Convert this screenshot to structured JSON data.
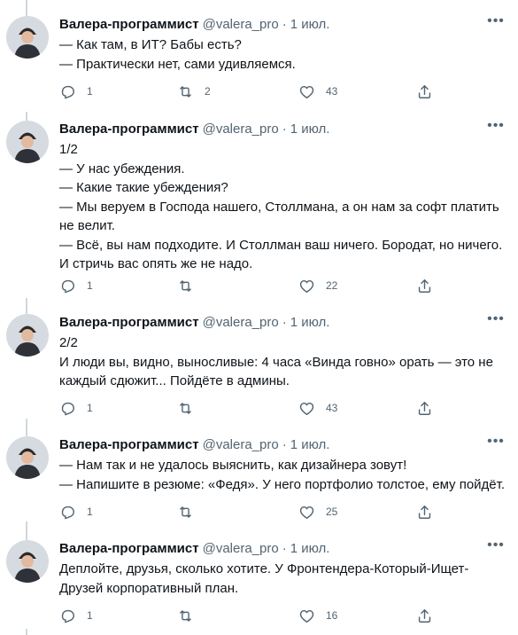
{
  "tweets": [
    {
      "name": "Валера-программист",
      "handle": "@valera_pro",
      "dot": "·",
      "date": "1 июл.",
      "text": "— Как там, в ИТ? Бабы есть?\n— Практически нет, сами удивляемся.",
      "replies": "1",
      "retweets": "2",
      "likes": "43"
    },
    {
      "name": "Валера-программист",
      "handle": "@valera_pro",
      "dot": "·",
      "date": "1 июл.",
      "text": "1/2\n— У нас убеждения.\n— Какие такие убеждения?\n— Мы веруем в Господа нашего, Столлмана, а он нам за софт платить не велит.\n— Всё, вы нам подходите. И Столлман ваш ничего. Бородат, но ничего. И стричь вас опять же не надо.",
      "replies": "1",
      "retweets": "",
      "likes": "22"
    },
    {
      "name": "Валера-программист",
      "handle": "@valera_pro",
      "dot": "·",
      "date": "1 июл.",
      "text": "2/2\nИ люди вы, видно, выносливые: 4 часа «Винда говно» орать — это не каждый сдюжит... Пойдёте в админы.",
      "replies": "1",
      "retweets": "",
      "likes": "43"
    },
    {
      "name": "Валера-программист",
      "handle": "@valera_pro",
      "dot": "·",
      "date": "1 июл.",
      "text": "— Нам так и не удалось выяснить, как дизайнера зовут!\n— Напишите в резюме: «Федя». У него портфолио толстое, ему пойдёт.",
      "replies": "1",
      "retweets": "",
      "likes": "25"
    },
    {
      "name": "Валера-программист",
      "handle": "@valera_pro",
      "dot": "·",
      "date": "1 июл.",
      "text": "Деплойте, друзья, сколько хотите. У Фронтендера-Который-Ищет-Друзей корпоративный план.",
      "replies": "1",
      "retweets": "",
      "likes": "16"
    }
  ],
  "icons": {
    "more": "more-icon",
    "reply": "reply-icon",
    "retweet": "retweet-icon",
    "like": "like-icon",
    "share": "share-icon"
  },
  "colors": {
    "text": "#0f1419",
    "secondary": "#536471",
    "thread_line": "#cfd9de"
  }
}
